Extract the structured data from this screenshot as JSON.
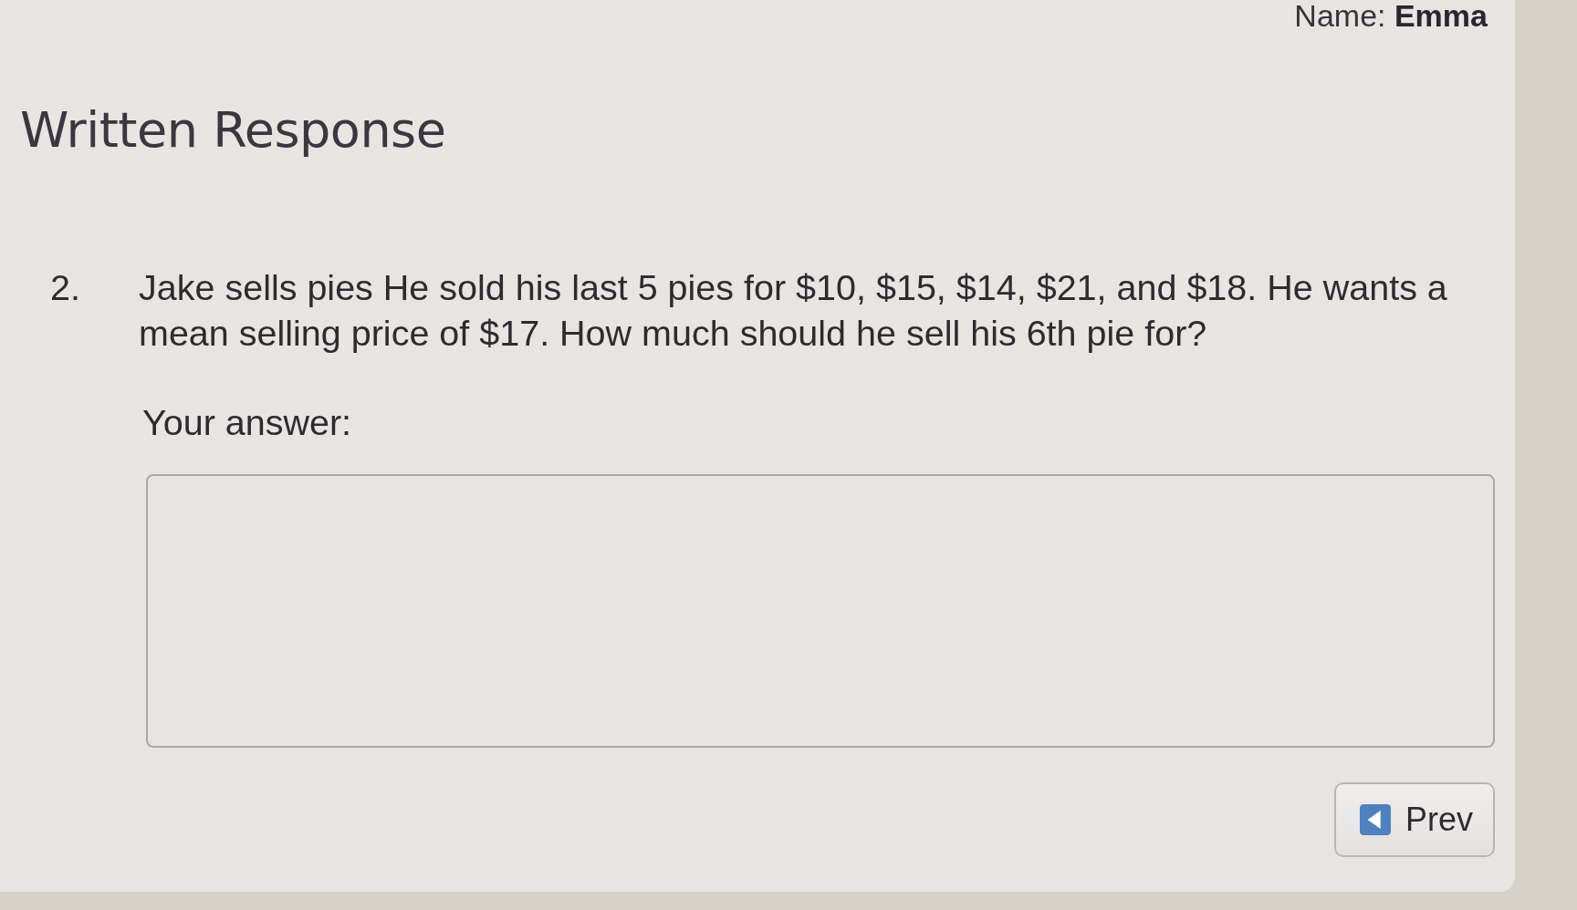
{
  "header": {
    "name_line": "Name: **Emma**"
  },
  "section_title": "Written Response",
  "question": {
    "number": "2.",
    "text": "Jake sells pies He sold his last 5 pies for $10, $15, $14, $21, and $18. He wants a mean selling price of $17. How much should he sell his 6th pie for?",
    "answer_label": "Your answer:"
  },
  "navigation": [
    {
      "kind": "prev",
      "label": "Prev"
    }
  ]
}
